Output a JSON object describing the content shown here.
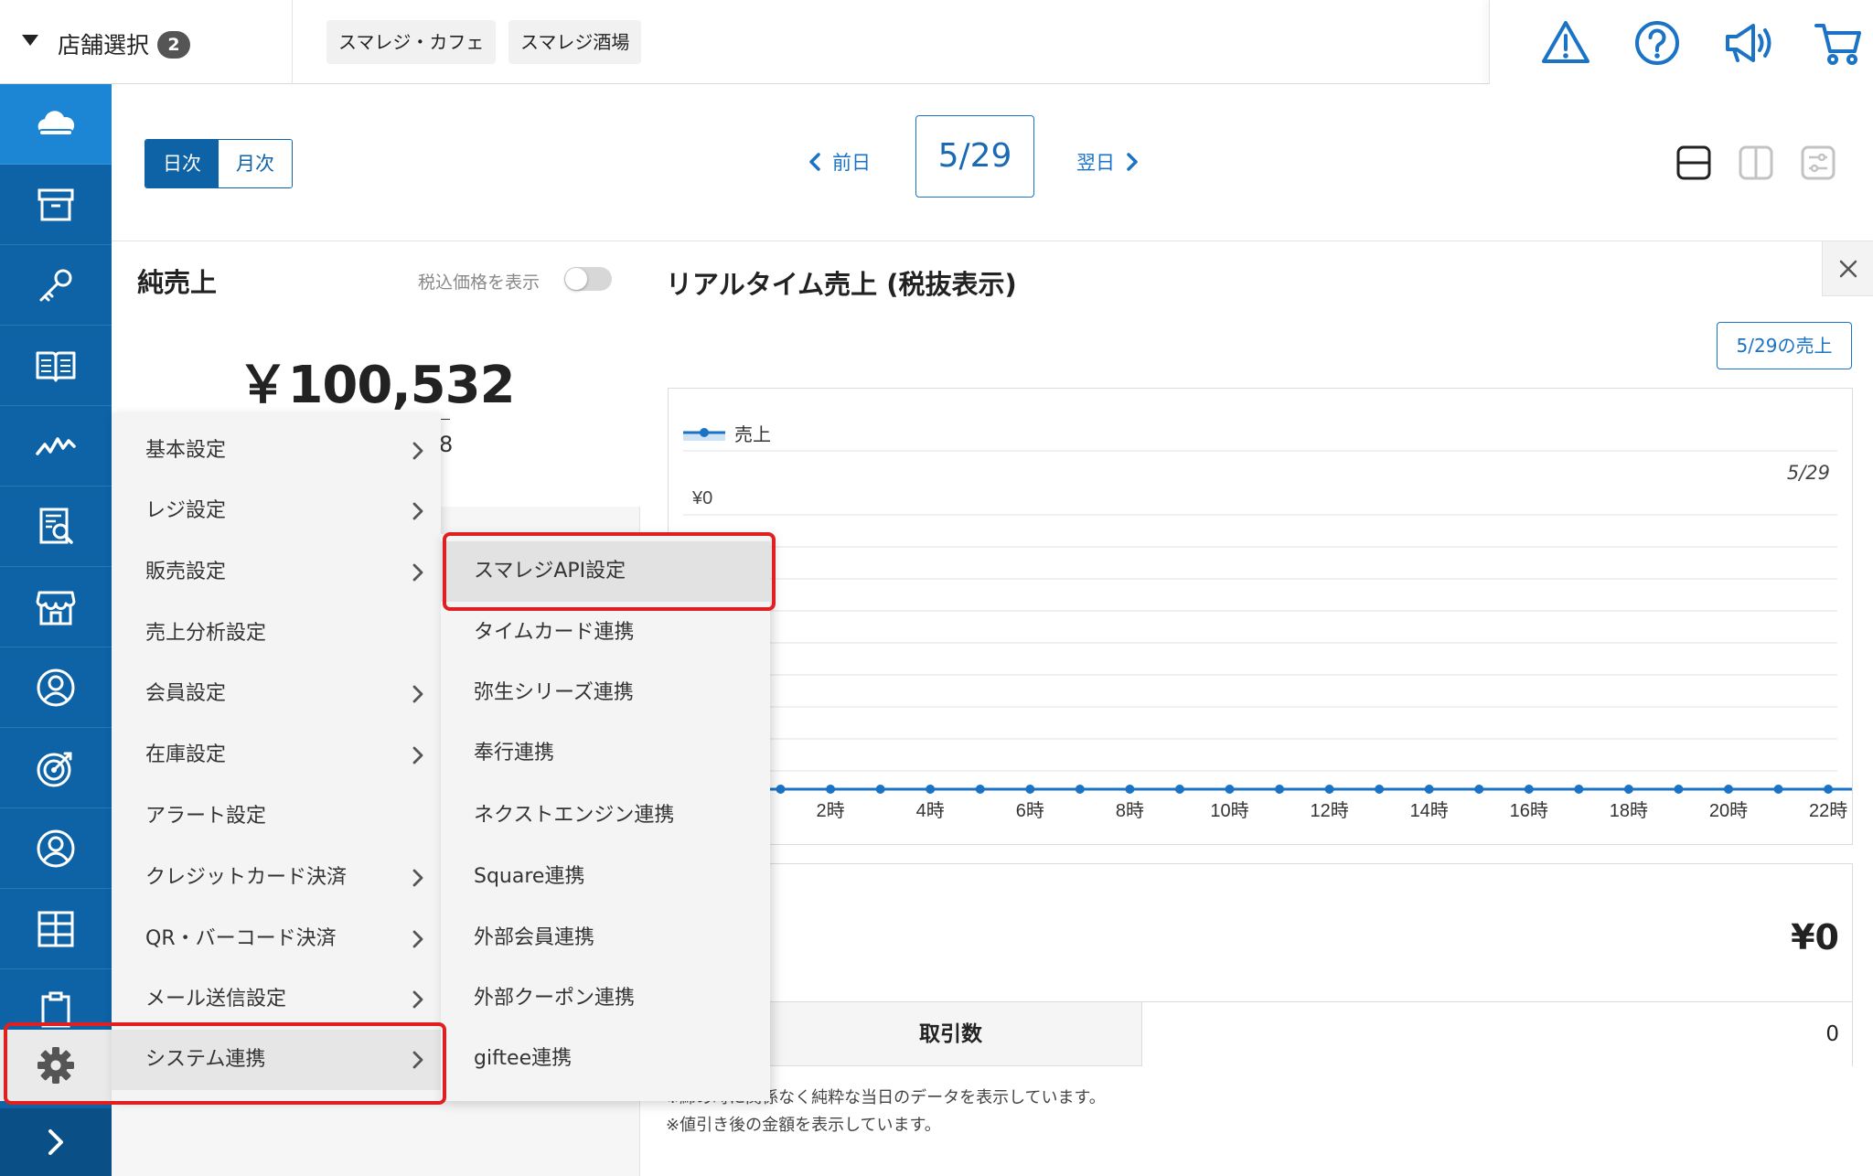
{
  "header": {
    "store_select_label": "店舗選択",
    "store_count": "2",
    "stores": [
      "スマレジ・カフェ",
      "スマレジ酒場"
    ],
    "icons": [
      "alert-icon",
      "help-icon",
      "megaphone-icon",
      "cart-icon"
    ]
  },
  "toolbar": {
    "daily_label": "日次",
    "monthly_label": "月次",
    "prev_label": "前日",
    "current_date": "5/29",
    "next_label": "翌日"
  },
  "left_panel": {
    "title": "純売上",
    "tax_toggle_label": "税込価格を表示",
    "net_sales": "￥100,532",
    "partial_text": "8"
  },
  "main": {
    "title": "リアルタイム売上 (税抜表示)",
    "sales_button": "5/29の売上",
    "legend_label": "売上",
    "date_annotation": "5/29",
    "partial_axis_label": "¥0",
    "total": "¥0",
    "transaction_label": "取引数",
    "transaction_count": "0",
    "notes": [
      "※締め時に関係なく純粋な当日のデータを表示しています。",
      "※値引き後の金額を表示しています。"
    ]
  },
  "chart_data": {
    "type": "line",
    "x_tick_labels": [
      "2時",
      "4時",
      "6時",
      "8時",
      "10時",
      "12時",
      "14時",
      "16時",
      "18時",
      "20時",
      "22時"
    ],
    "series": [
      {
        "name": "売上",
        "values": [
          0,
          0,
          0,
          0,
          0,
          0,
          0,
          0,
          0,
          0,
          0,
          0,
          0,
          0,
          0,
          0,
          0,
          0,
          0,
          0,
          0,
          0,
          0,
          0
        ]
      }
    ],
    "color": "#1a73c4"
  },
  "settings_menu": {
    "items": [
      {
        "label": "基本設定",
        "has_submenu": true
      },
      {
        "label": "レジ設定",
        "has_submenu": true
      },
      {
        "label": "販売設定",
        "has_submenu": true
      },
      {
        "label": "売上分析設定",
        "has_submenu": false
      },
      {
        "label": "会員設定",
        "has_submenu": true
      },
      {
        "label": "在庫設定",
        "has_submenu": true
      },
      {
        "label": "アラート設定",
        "has_submenu": false
      },
      {
        "label": "クレジットカード決済",
        "has_submenu": true
      },
      {
        "label": "QR・バーコード決済",
        "has_submenu": true
      },
      {
        "label": "メール送信設定",
        "has_submenu": true
      },
      {
        "label": "システム連携",
        "has_submenu": true
      }
    ]
  },
  "system_submenu": {
    "items": [
      "スマレジAPI設定",
      "タイムカード連携",
      "弥生シリーズ連携",
      "奉行連携",
      "ネクストエンジン連携",
      "Square連携",
      "外部会員連携",
      "外部クーポン連携",
      "giftee連携"
    ]
  },
  "colors": {
    "sidebar": "#0d63a6",
    "accent": "#1a73c4",
    "highlight": "#e02020"
  }
}
